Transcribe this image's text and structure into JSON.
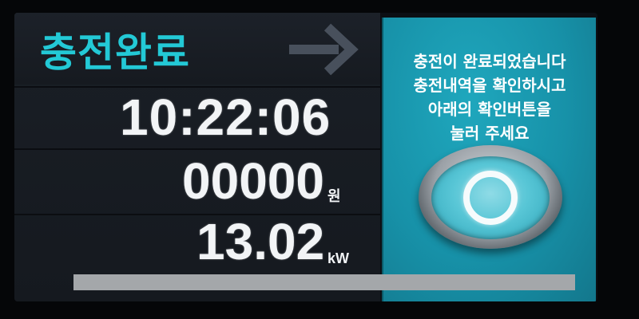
{
  "header": {
    "status_title": "충전완료",
    "arrow_icon": "right-arrow-icon"
  },
  "readings": {
    "elapsed_time": "10:22:06",
    "charge_cost": "00000",
    "cost_unit": "원",
    "charged_energy": "13.02",
    "energy_unit": "kW"
  },
  "progress": {
    "fraction": 1.0
  },
  "instruction": {
    "lines": [
      "충전이 완료되었습니다",
      "충전내역을 확인하시고",
      "아래의 확인버튼을",
      "눌러 주세요"
    ]
  },
  "confirm_button": {
    "icon": "circle-icon"
  },
  "colors": {
    "accent": "#23c9d6",
    "panel_teal": "#1791a8"
  }
}
